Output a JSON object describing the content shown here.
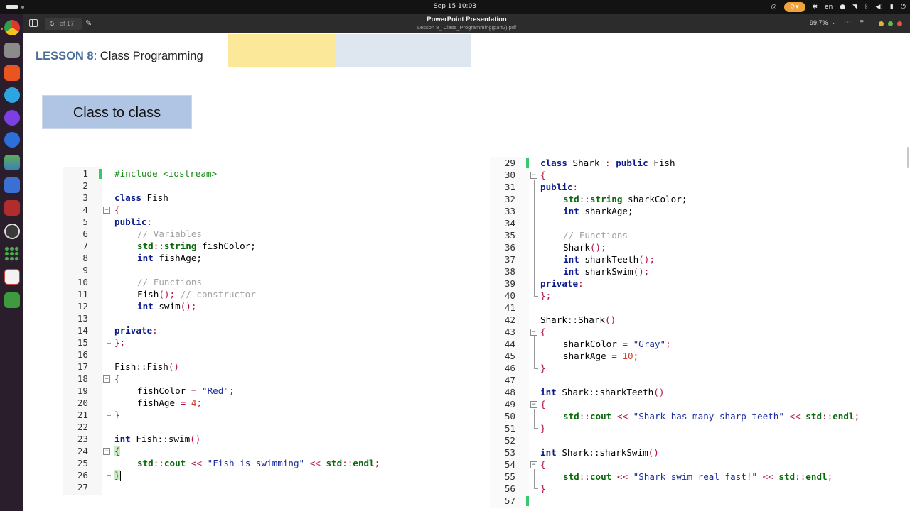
{
  "topbar": {
    "clock": "Sep 15  10:03",
    "lang": "en"
  },
  "header": {
    "page_current": "5",
    "page_of": "of 17",
    "title": "PowerPoint Presentation",
    "subtitle": "Lesson 8_ Class_Programming(part2).pdf",
    "zoom": "99.7%"
  },
  "slide": {
    "lesson_prefix": "LESSON 8",
    "lesson_suffix": ": Class Programming",
    "heading": "Class to class"
  },
  "left_code": {
    "line_numbers": [
      "1",
      "2",
      "3",
      "4",
      "5",
      "6",
      "7",
      "8",
      "9",
      "10",
      "11",
      "12",
      "13",
      "14",
      "15",
      "16",
      "17",
      "18",
      "19",
      "20",
      "21",
      "22",
      "23",
      "24",
      "25",
      "26",
      "27"
    ],
    "tokens": {
      "include": "#include <iostream>",
      "class_kw": "class",
      "fish": "Fish",
      "brace_open": "{",
      "brace_close": "}",
      "semi_close": "};",
      "public": "public",
      "colon": ":",
      "private": "private",
      "cm_variables": "// Variables",
      "cm_functions": "// Functions",
      "cm_constructor": "// constructor",
      "std": "std",
      "scope": "::",
      "string_kw": "string",
      "fishColor_decl": " fishColor;",
      "int_kw": "int",
      "fishAge_decl": " fishAge;",
      "fish_ctor_decl": "Fish",
      "parens_semi": "();",
      "swim_decl": " swim",
      "fish_ctor_def": "Fish::Fish",
      "parens": "()",
      "fishColor_assign": "fishColor ",
      "eq": "=",
      "red_str": "\"Red\"",
      "semi": ";",
      "fishAge_assign": "fishAge ",
      "four": "4",
      "swim_def": " Fish::swim",
      "cout": "cout",
      "shift": "<<",
      "swim_str": "\"Fish is swimming\"",
      "endl": "endl"
    }
  },
  "right_code": {
    "line_numbers": [
      "29",
      "30",
      "31",
      "32",
      "33",
      "34",
      "35",
      "36",
      "37",
      "38",
      "39",
      "40",
      "41",
      "42",
      "43",
      "44",
      "45",
      "46",
      "47",
      "48",
      "49",
      "50",
      "51",
      "52",
      "53",
      "54",
      "55",
      "56",
      "57"
    ],
    "tokens": {
      "class_kw": "class",
      "shark_decl": " Shark ",
      "colon": ":",
      "public": "public",
      "fish_base": " Fish",
      "brace_open": "{",
      "brace_close": "}",
      "semi_close": "};",
      "std": "std",
      "scope": "::",
      "string_kw": "string",
      "sharkColor_decl": " sharkColor;",
      "int_kw": "int",
      "sharkAge_decl": " sharkAge;",
      "cm_functions": "// Functions",
      "shark_ctor_decl": "Shark",
      "parens_semi": "();",
      "sharkTeeth_decl": " sharkTeeth",
      "sharkSwim_decl": " sharkSwim",
      "private": "private",
      "shark_ctor_def": "Shark::Shark",
      "parens": "()",
      "sharkColor_assign": "sharkColor ",
      "eq": "=",
      "gray_str": "\"Gray\"",
      "semi": ";",
      "sharkAge_assign": "sharkAge ",
      "ten": "10",
      "teeth_def": " Shark::sharkTeeth",
      "swim_def": " Shark::sharkSwim",
      "cout": "cout",
      "shift": "<<",
      "teeth_str": "\"Shark has many sharp teeth\"",
      "swim_str": "\"Shark swim real fast!\"",
      "endl": "endl"
    }
  },
  "colors": {
    "keyword": "#0b1b8c",
    "type": "#0b6b0b",
    "comment": "#a3a3a3",
    "string": "#1d2fa0",
    "number": "#c9412c",
    "lesson_accent": "#4a6d9c",
    "heading_box": "#afc5e3"
  }
}
